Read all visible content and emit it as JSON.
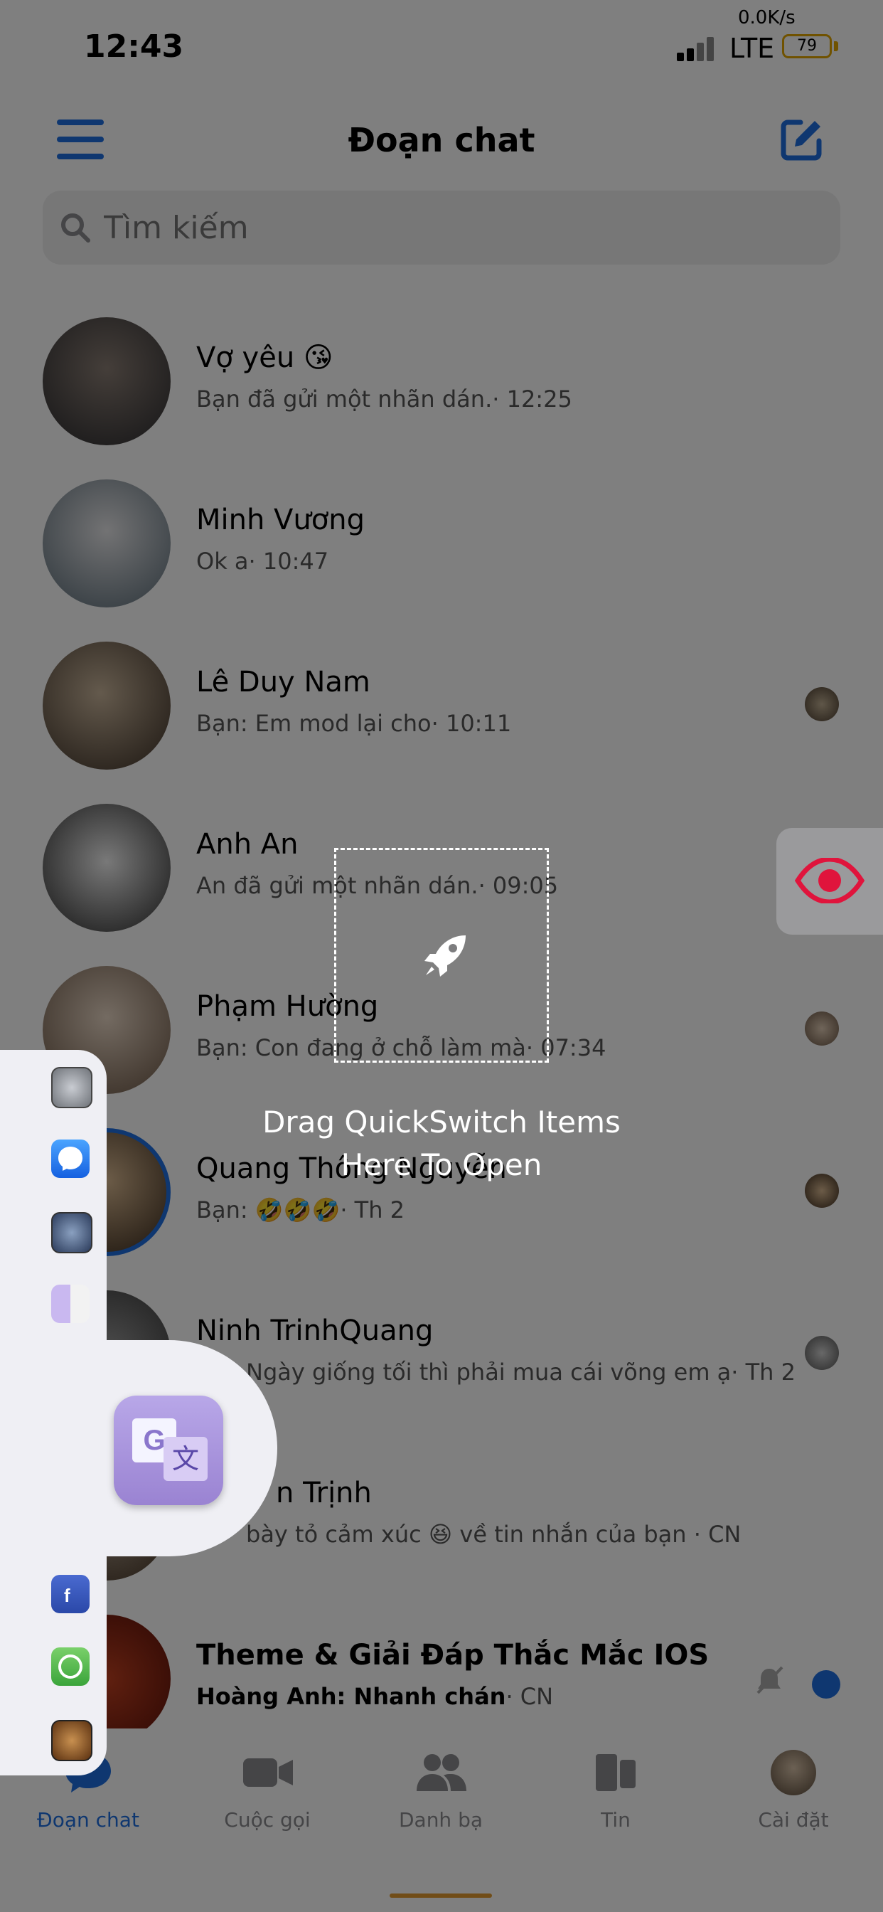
{
  "status_bar": {
    "time": "12:43",
    "net_speed": "0.0K/s",
    "network": "LTE",
    "battery": "79"
  },
  "header": {
    "title": "Đoạn chat",
    "menu_icon": "hamburger-menu-icon",
    "compose_icon": "compose-icon"
  },
  "search": {
    "placeholder": "Tìm kiếm"
  },
  "chats": [
    {
      "name": "Vợ yêu 😘",
      "preview": "Bạn đã gửi một nhãn dán.· 12:25"
    },
    {
      "name": "Minh Vương",
      "preview": "Ok a· 10:47"
    },
    {
      "name": "Lê Duy Nam",
      "preview": "Bạn: Em mod lại cho· 10:11"
    },
    {
      "name": "Anh An",
      "preview": "An đã gửi một nhãn dán.· 09:05"
    },
    {
      "name": "Phạm Hường",
      "preview": "Bạn: Con đang ở chỗ làm mà· 07:34"
    },
    {
      "name": "Quang Thông Nguyễn",
      "preview": "Bạn: 🤣🤣🤣· Th 2"
    },
    {
      "name": "Ninh TrinhQuang",
      "preview": "Ngày giống tối thì phải mua cái võng em ạ· Th 2"
    },
    {
      "name": "n Trịnh",
      "preview": "bày tỏ cảm xúc 😆 về tin nhắn của bạn · CN"
    },
    {
      "name": "Theme & Giải Đáp Thắc Mắc IOS",
      "preview_bold": "Hoàng Anh: Nhanh chán",
      "preview_time": "· CN"
    }
  ],
  "tabs": [
    {
      "label": "Đoạn chat",
      "icon": "chat-bubble-icon",
      "active": true
    },
    {
      "label": "Cuộc gọi",
      "icon": "video-camera-icon"
    },
    {
      "label": "Danh bạ",
      "icon": "people-icon"
    },
    {
      "label": "Tin",
      "icon": "stories-icon"
    },
    {
      "label": "Cài đặt",
      "icon": "profile-avatar-icon"
    }
  ],
  "overlay": {
    "drop_text_line1": "Drag QuickSwitch Items",
    "drop_text_line2": "Here To Open",
    "drop_icon": "rocket-icon",
    "toggle_icon": "eye-icon",
    "dock_apps": [
      "settings-app-icon",
      "messenger-app-icon",
      "safari-app-icon",
      "finder-app-icon",
      "facebook-app-icon",
      "whatsapp-app-icon",
      "photo-app-icon"
    ],
    "focused_app": "google-translate-app-icon"
  },
  "colors": {
    "accent": "#1f6fe0",
    "battery": "#e0a400",
    "eye": "#e0143c"
  }
}
